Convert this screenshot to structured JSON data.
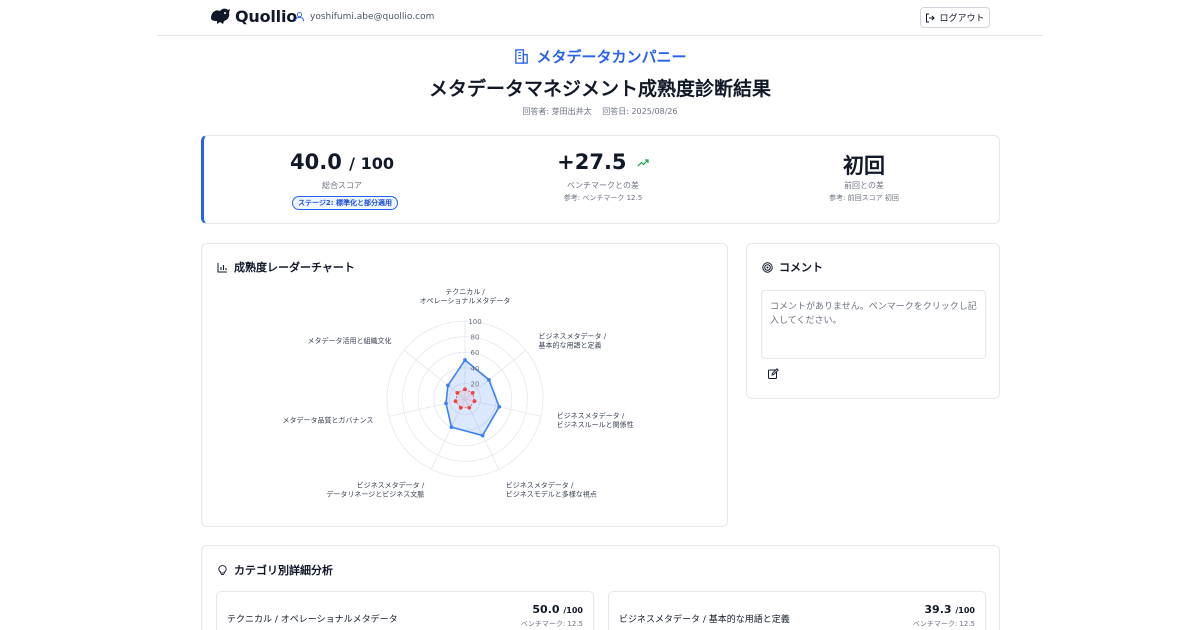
{
  "header": {
    "logo_text": "Quollio",
    "user_email": "yoshifumi.abe@quollio.com",
    "logout_label": "ログアウト"
  },
  "company": "メタデータカンパニー",
  "title": "メタデータマネジメント成熟度診断結果",
  "meta": {
    "respondent": "回答者: 芽田出井太",
    "date": "回答日: 2025/08/26"
  },
  "scores": {
    "total": {
      "value": "40.0",
      "max": "/ 100",
      "label": "総合スコア",
      "badge": "ステージ2: 標準化と部分適用"
    },
    "benchmark": {
      "value": "+27.5",
      "label": "ベンチマークとの差",
      "ref": "参考: ベンチマーク 12.5"
    },
    "previous": {
      "value": "初回",
      "label": "前回との差",
      "ref": "参考: 前回スコア 初回"
    }
  },
  "radar_card": {
    "title": "成熟度レーダーチャート"
  },
  "chart_data": {
    "type": "radar",
    "title": "成熟度レーダーチャート",
    "range": [
      0,
      100
    ],
    "ticks": [
      "20",
      "40",
      "60",
      "80",
      "100"
    ],
    "axes": [
      [
        "テクニカル /",
        "オペレーショナルメタデータ"
      ],
      [
        "ビジネスメタデータ /",
        "基本的な用語と定義"
      ],
      [
        "ビジネスメタデータ /",
        "ビジネスルールと関係性"
      ],
      [
        "ビジネスメタデータ /",
        "ビジネスモデルと多様な視点"
      ],
      [
        "ビジネスメタデータ /",
        "データリネージとビジネス文脈"
      ],
      [
        "メタデータ品質とガバナンス"
      ],
      [
        "メタデータ活用と組織文化"
      ]
    ],
    "series": [
      {
        "values": [
          50,
          39.3,
          45,
          52,
          40,
          25,
          28
        ],
        "color": "#3b82f6"
      },
      {
        "values": [
          12.5,
          12.5,
          12.5,
          12.5,
          12.5,
          12.5,
          12.5
        ],
        "color": "#ef4444"
      }
    ],
    "grid": true
  },
  "comment": {
    "title": "コメント",
    "placeholder": "コメントがありません。ペンマークをクリックし記入してください。"
  },
  "category": {
    "title": "カテゴリ別詳細分析",
    "items": [
      {
        "name": "テクニカル / オペレーショナルメタデータ",
        "score": "50.0",
        "max": "/100",
        "benchmark": "ベンチマーク: 12.5"
      },
      {
        "name": "ビジネスメタデータ / 基本的な用語と定義",
        "score": "39.3",
        "max": "/100",
        "benchmark": "ベンチマーク: 12.5"
      }
    ]
  }
}
